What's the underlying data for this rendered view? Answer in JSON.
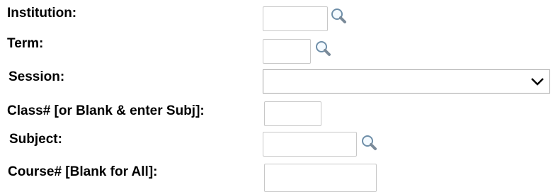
{
  "form": {
    "institution": {
      "label": "Institution:",
      "value": "",
      "lookup_icon": "magnifier-icon"
    },
    "term": {
      "label": "Term:",
      "value": "",
      "lookup_icon": "magnifier-icon"
    },
    "session": {
      "label": "Session:",
      "selected": "",
      "dropdown_icon": "chevron-down-icon"
    },
    "class_nbr": {
      "label": "Class# [or Blank & enter Subj]:",
      "value": ""
    },
    "subject": {
      "label": "Subject:",
      "value": "",
      "lookup_icon": "magnifier-icon"
    },
    "course_nbr": {
      "label": "Course# [Blank for All]:",
      "value": ""
    }
  }
}
